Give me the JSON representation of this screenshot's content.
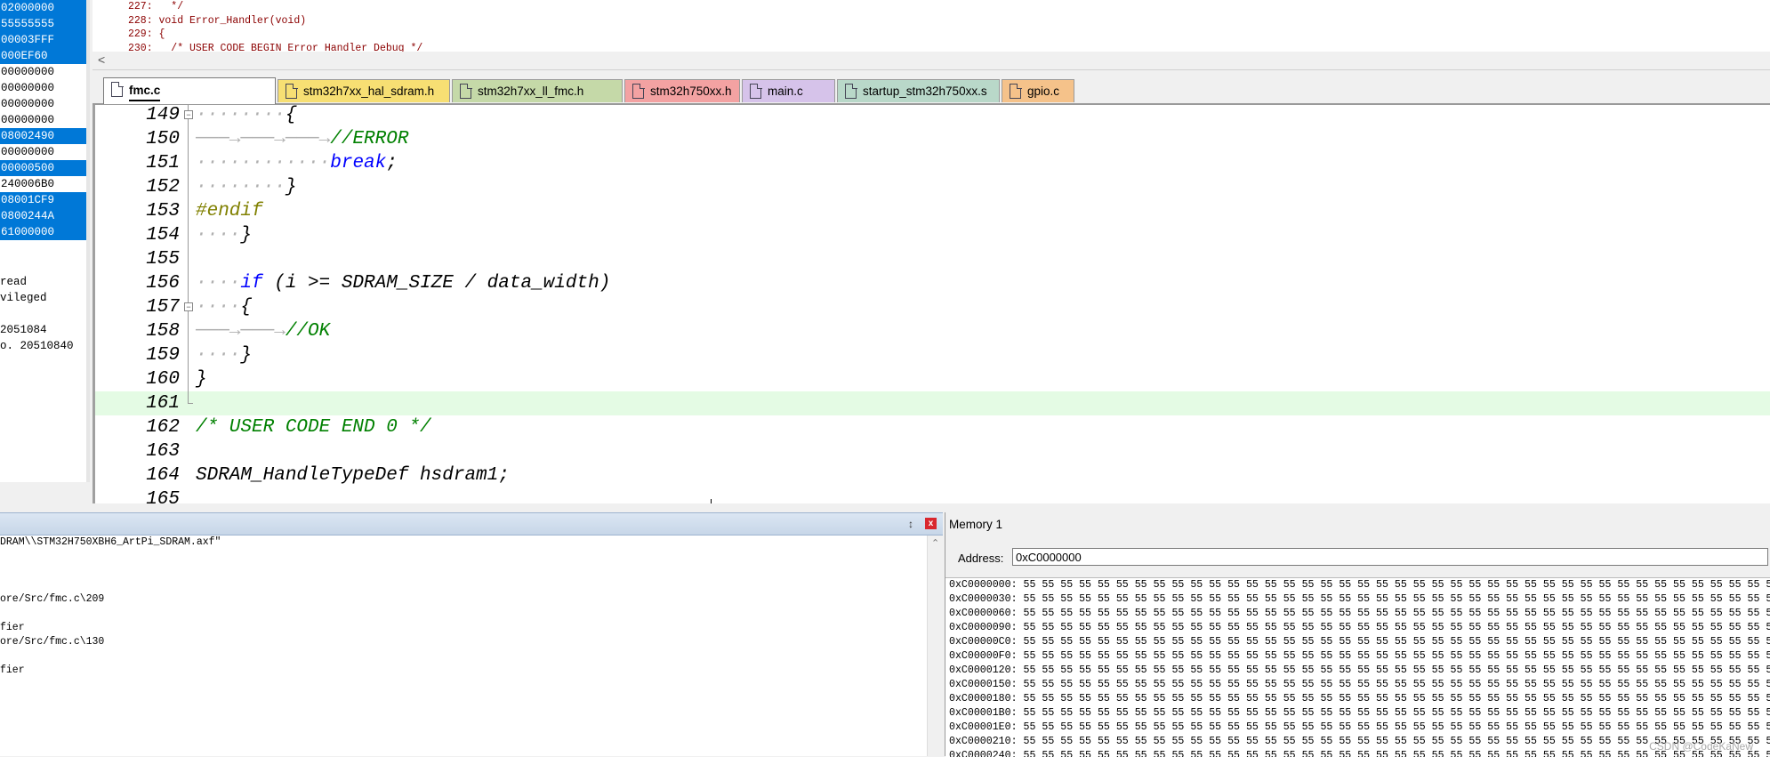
{
  "registers": {
    "values": [
      "02000000",
      "55555555",
      "00003FFF",
      "000EF60",
      "00000000",
      "00000000",
      "00000000",
      "00000000",
      "08002490",
      "00000000",
      "00000500",
      "240006B0",
      "08001CF9",
      "0800244A",
      "61000000"
    ],
    "selected": [
      true,
      true,
      true,
      true,
      false,
      false,
      false,
      false,
      true,
      false,
      true,
      false,
      true,
      true,
      true
    ],
    "modes": [
      "read",
      "vileged",
      "",
      "2051084",
      "o. 20510840"
    ]
  },
  "disassembly": {
    "lines": [
      "227:   */",
      "228: void Error_Handler(void)",
      "229: {",
      "230:   /* USER CODE BEGIN Error Handler Debug */"
    ],
    "scroll_left_glyph": "<"
  },
  "tabs": [
    {
      "label": "fmc.c",
      "color": "#ffffff",
      "active": true
    },
    {
      "label": "stm32h7xx_hal_sdram.h",
      "color": "#f7df73"
    },
    {
      "label": "stm32h7xx_ll_fmc.h",
      "color": "#c5d9a8"
    },
    {
      "label": "stm32h750xx.h",
      "color": "#f3a2a2"
    },
    {
      "label": "main.c",
      "color": "#d6c3ea"
    },
    {
      "label": "startup_stm32h750xx.s",
      "color": "#b9d8c9"
    },
    {
      "label": "gpio.c",
      "color": "#f5c28a"
    }
  ],
  "editor": {
    "lines": [
      {
        "num": "149",
        "ws": "········",
        "code": "{"
      },
      {
        "num": "150",
        "ws": "───→───→───→",
        "comment": "//ERROR"
      },
      {
        "num": "151",
        "ws": "············",
        "kw": "break",
        "code": ";"
      },
      {
        "num": "152",
        "ws": "········",
        "code": "}"
      },
      {
        "num": "153",
        "pp": "#endif"
      },
      {
        "num": "154",
        "ws": "····",
        "code": "}"
      },
      {
        "num": "155"
      },
      {
        "num": "156",
        "ws": "····",
        "kw": "if",
        "code": " (i >= SDRAM_SIZE / data_width)"
      },
      {
        "num": "157",
        "ws": "····",
        "code": "{"
      },
      {
        "num": "158",
        "ws": "───→───→",
        "comment": "//OK"
      },
      {
        "num": "159",
        "ws": "····",
        "code": "}"
      },
      {
        "num": "160",
        "code": "}"
      },
      {
        "num": "161"
      },
      {
        "num": "162",
        "comment": "/* USER CODE END 0 */"
      },
      {
        "num": "163"
      },
      {
        "num": "164",
        "code": "SDRAM_HandleTypeDef hsdram1;"
      },
      {
        "num": "165"
      }
    ]
  },
  "command": {
    "pin_glyph": "↕",
    "close_glyph": "x",
    "lines": [
      "DRAM\\\\STM32H750XBH6_ArtPi_SDRAM.axf\"",
      "",
      "",
      "",
      "ore/Src/fmc.c\\209",
      "",
      "fier",
      "ore/Src/fmc.c\\130",
      "",
      "fier"
    ]
  },
  "memory": {
    "title": "Memory 1",
    "address_label": "Address:",
    "address_value": "0xC0000000",
    "rows": [
      {
        "addr": "0xC0000000:",
        "bytes": "55"
      },
      {
        "addr": "0xC0000030:",
        "bytes": "55"
      },
      {
        "addr": "0xC0000060:",
        "bytes": "55"
      },
      {
        "addr": "0xC0000090:",
        "bytes": "55"
      },
      {
        "addr": "0xC00000C0:",
        "bytes": "55"
      },
      {
        "addr": "0xC00000F0:",
        "bytes": "55"
      },
      {
        "addr": "0xC0000120:",
        "bytes": "55"
      },
      {
        "addr": "0xC0000150:",
        "bytes": "55"
      },
      {
        "addr": "0xC0000180:",
        "bytes": "55"
      },
      {
        "addr": "0xC00001B0:",
        "bytes": "55"
      },
      {
        "addr": "0xC00001E0:",
        "bytes": "55"
      },
      {
        "addr": "0xC0000210:",
        "bytes": "55"
      },
      {
        "addr": "0xC0000240:",
        "bytes": "55"
      }
    ],
    "watermark": "CSDN @CodeKaNew"
  }
}
